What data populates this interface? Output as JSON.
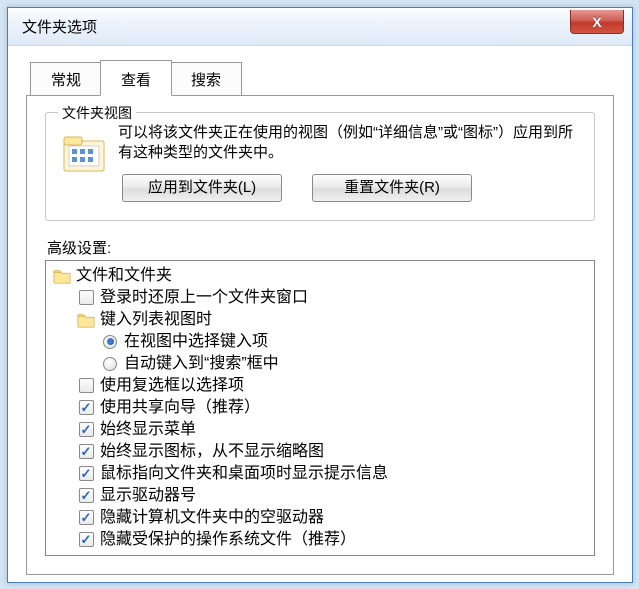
{
  "title": "文件夹选项",
  "close_glyph": "X",
  "tabs": {
    "general": "常规",
    "view": "查看",
    "search": "搜索",
    "active_index": 1
  },
  "group": {
    "legend": "文件夹视图",
    "desc": "可以将该文件夹正在使用的视图（例如“详细信息”或“图标”）应用到所有这种类型的文件夹中。",
    "apply_btn": "应用到文件夹(L)",
    "reset_btn": "重置文件夹(R)"
  },
  "advanced_label": "高级设置:",
  "tree": [
    {
      "indent": 0,
      "type": "folder",
      "label": "文件和文件夹"
    },
    {
      "indent": 1,
      "type": "check",
      "checked": false,
      "label": "登录时还原上一个文件夹窗口"
    },
    {
      "indent": 1,
      "type": "folder",
      "label": "键入列表视图时"
    },
    {
      "indent": 2,
      "type": "radio",
      "checked": true,
      "label": "在视图中选择键入项"
    },
    {
      "indent": 2,
      "type": "radio",
      "checked": false,
      "label": "自动键入到“搜索”框中"
    },
    {
      "indent": 1,
      "type": "check",
      "checked": false,
      "label": "使用复选框以选择项"
    },
    {
      "indent": 1,
      "type": "check",
      "checked": true,
      "label": "使用共享向导（推荐）"
    },
    {
      "indent": 1,
      "type": "check",
      "checked": true,
      "label": "始终显示菜单"
    },
    {
      "indent": 1,
      "type": "check",
      "checked": true,
      "label": "始终显示图标，从不显示缩略图"
    },
    {
      "indent": 1,
      "type": "check",
      "checked": true,
      "label": "鼠标指向文件夹和桌面项时显示提示信息"
    },
    {
      "indent": 1,
      "type": "check",
      "checked": true,
      "label": "显示驱动器号"
    },
    {
      "indent": 1,
      "type": "check",
      "checked": true,
      "label": "隐藏计算机文件夹中的空驱动器"
    },
    {
      "indent": 1,
      "type": "check",
      "checked": true,
      "label": "隐藏受保护的操作系统文件（推荐）"
    }
  ]
}
